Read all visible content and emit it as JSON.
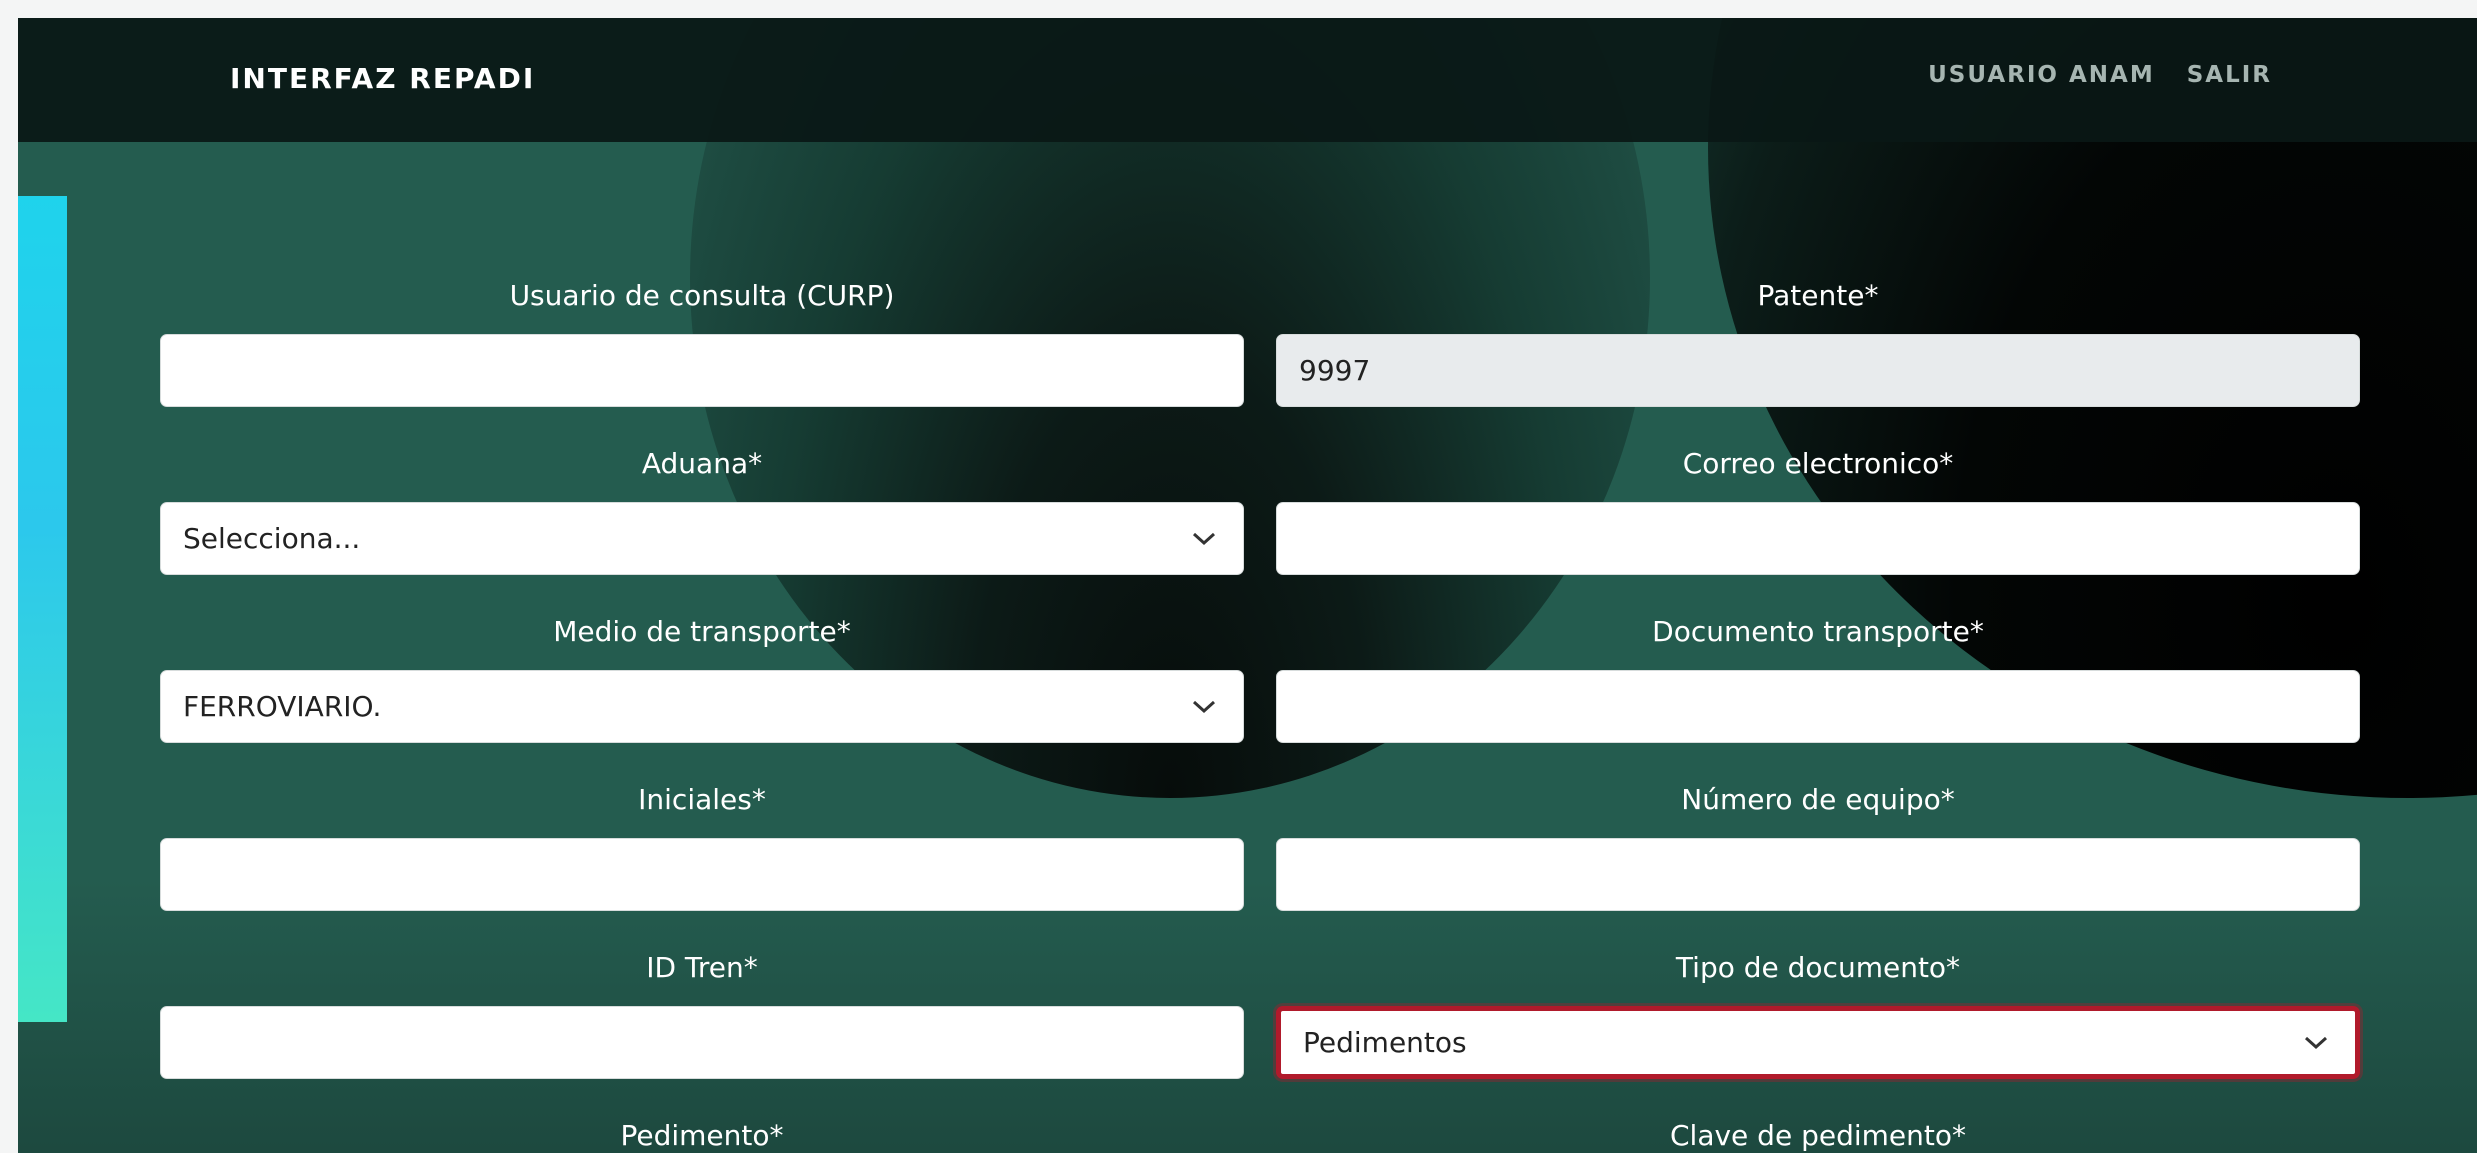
{
  "navbar": {
    "brand": "INTERFAZ REPADI",
    "user_label": "USUARIO ANAM",
    "logout_label": "SALIR"
  },
  "form": {
    "curp": {
      "label": "Usuario de consulta (CURP)",
      "value": ""
    },
    "patente": {
      "label": "Patente*",
      "value": "9997"
    },
    "aduana": {
      "label": "Aduana*",
      "value": "Selecciona..."
    },
    "correo": {
      "label": "Correo electronico*",
      "value": ""
    },
    "medio_transporte": {
      "label": "Medio de transporte*",
      "value": "FERROVIARIO."
    },
    "documento_transporte": {
      "label": "Documento transporte*",
      "value": ""
    },
    "iniciales": {
      "label": "Iniciales*",
      "value": ""
    },
    "numero_equipo": {
      "label": "Número de equipo*",
      "value": ""
    },
    "id_tren": {
      "label": "ID Tren*",
      "value": ""
    },
    "tipo_documento": {
      "label": "Tipo de documento*",
      "value": "Pedimentos"
    },
    "pedimento": {
      "label": "Pedimento*"
    },
    "clave_pedimento": {
      "label": "Clave de pedimento*"
    }
  },
  "colors": {
    "background": "#245c4f",
    "navbar": "#0a1815",
    "accent_gradient_top": "#1fd3ec",
    "accent_gradient_bottom": "#45e6c6",
    "invalid_border": "#b11a2b",
    "readonly_input": "#e8ebed"
  },
  "icons": {
    "select_arrow": "chevron-down-icon"
  }
}
